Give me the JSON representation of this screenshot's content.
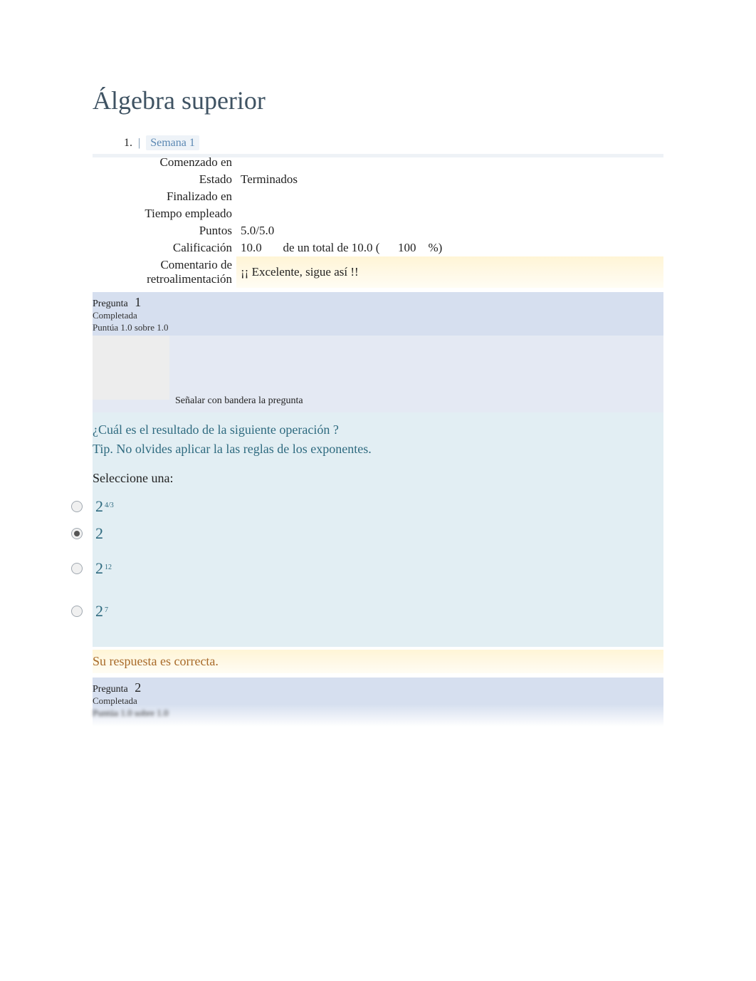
{
  "course_title": "Álgebra superior",
  "breadcrumb": {
    "number": "1.",
    "separator": "|",
    "link": "Semana 1"
  },
  "summary": {
    "labels": {
      "started": "Comenzado en",
      "state": "Estado",
      "finished": "Finalizado en",
      "time": "Tiempo empleado",
      "points": "Puntos",
      "grade": "Calificación",
      "feedback": "Comentario de retroalimentación"
    },
    "values": {
      "started": "",
      "state": "Terminados",
      "finished": "",
      "time": "",
      "points": "5.0/5.0",
      "grade_num": "10.0",
      "grade_mid": "de un total de 10.0 (",
      "grade_pct": "100",
      "grade_tail": "%)",
      "feedback": "¡¡ Excelente, sigue así !!"
    }
  },
  "question1": {
    "label": "Pregunta",
    "number": "1",
    "status": "Completada",
    "score": "Puntúa 1.0 sobre 1.0",
    "flag": "Señalar con bandera la pregunta",
    "prompt": "¿Cuál es el resultado de la siguiente operación ?",
    "tip": "Tip. No olvides aplicar la las reglas de los exponentes.",
    "select": "Seleccione una:",
    "options": [
      {
        "base": "2",
        "exp": "4/3",
        "checked": false
      },
      {
        "base": "2",
        "exp": "",
        "checked": true
      },
      {
        "base": "2",
        "exp": "12",
        "checked": false
      },
      {
        "base": "2",
        "exp": "7",
        "checked": false
      }
    ],
    "answer": "Su respuesta es correcta."
  },
  "question2": {
    "label": "Pregunta",
    "number": "2",
    "status": "Completada",
    "score": "Puntúa 1.0 sobre 1.0"
  }
}
